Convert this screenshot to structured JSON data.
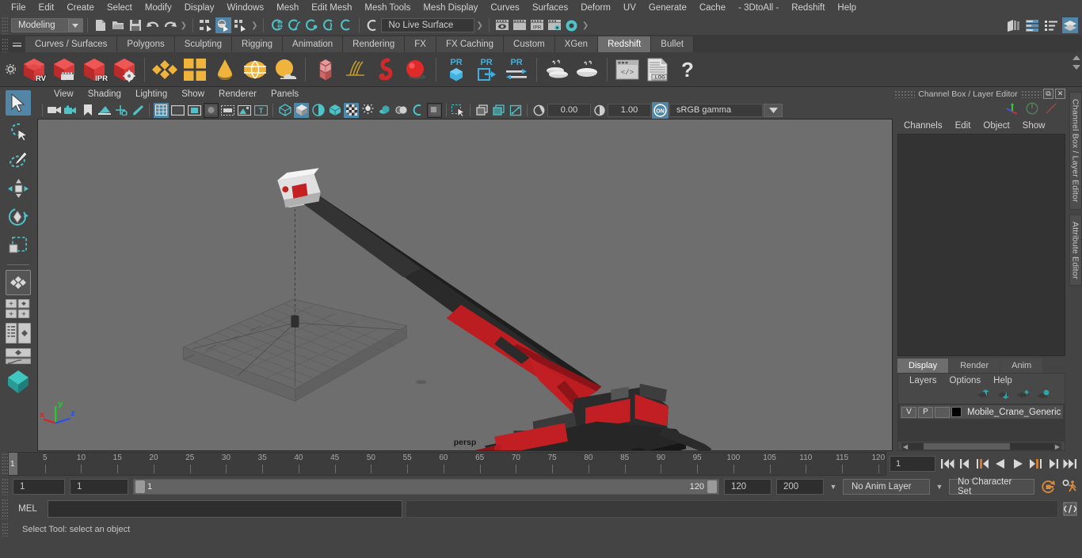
{
  "menu": {
    "items": [
      "File",
      "Edit",
      "Create",
      "Select",
      "Modify",
      "Display",
      "Windows",
      "Mesh",
      "Edit Mesh",
      "Mesh Tools",
      "Mesh Display",
      "Curves",
      "Surfaces",
      "Deform",
      "UV",
      "Generate",
      "Cache",
      "- 3DtoAll -",
      "Redshift",
      "Help"
    ]
  },
  "status": {
    "mode": "Modeling",
    "live_surface": "No Live Surface",
    "icons": [
      "new-scene-icon",
      "open-scene-icon",
      "save-scene-icon",
      "undo-icon",
      "redo-icon",
      "select-hierarchy-icon",
      "select-object-icon",
      "select-component-icon",
      "snap-grid-icon",
      "snap-curve-icon",
      "snap-point-icon",
      "snap-view-plane-icon",
      "make-live-icon",
      "render-view-icon",
      "render-sequence-icon",
      "ipr-render-icon",
      "render-settings-icon",
      "hypershade-icon"
    ]
  },
  "shelf": {
    "tabs": [
      "Curves / Surfaces",
      "Polygons",
      "Sculpting",
      "Rigging",
      "Animation",
      "Rendering",
      "FX",
      "FX Caching",
      "Custom",
      "XGen",
      "Redshift",
      "Bullet"
    ],
    "active_tab": "Redshift",
    "buttons": [
      {
        "name": "redshift-render-view",
        "label": "RV"
      },
      {
        "name": "redshift-render-sequence",
        "label": ""
      },
      {
        "name": "redshift-ipr",
        "label": "IPR"
      },
      {
        "name": "redshift-render-settings",
        "label": ""
      },
      {
        "name": "redshift-proxy",
        "label": ""
      },
      {
        "name": "redshift-matte",
        "label": ""
      },
      {
        "name": "redshift-light-dome",
        "label": ""
      },
      {
        "name": "redshift-environment",
        "label": ""
      },
      {
        "name": "redshift-sky",
        "label": ""
      },
      {
        "name": "redshift-volume",
        "label": ""
      },
      {
        "name": "redshift-hair",
        "label": ""
      },
      {
        "name": "redshift-curve",
        "label": ""
      },
      {
        "name": "redshift-sphere",
        "label": ""
      },
      {
        "name": "redshift-pr-proxy",
        "label": "PR"
      },
      {
        "name": "redshift-pr-export",
        "label": "PR"
      },
      {
        "name": "redshift-pr-transfer",
        "label": "PR"
      },
      {
        "name": "redshift-bake-set",
        "label": ""
      },
      {
        "name": "redshift-bake-all",
        "label": ""
      },
      {
        "name": "redshift-script-editor",
        "label": ""
      },
      {
        "name": "redshift-log",
        "label": ".LOG"
      },
      {
        "name": "redshift-help",
        "label": "?"
      }
    ]
  },
  "toolbox": {
    "items": [
      {
        "name": "select-tool",
        "selected": true
      },
      {
        "name": "lasso-select-tool",
        "selected": false
      },
      {
        "name": "paint-select-tool",
        "selected": false
      },
      {
        "name": "move-tool",
        "selected": false
      },
      {
        "name": "rotate-tool",
        "selected": false
      },
      {
        "name": "scale-tool",
        "selected": false
      },
      {
        "name": "last-tool-used",
        "selected": false
      },
      {
        "name": "layout-four-view",
        "selected": false
      },
      {
        "name": "layout-persp-outliner",
        "selected": false
      },
      {
        "name": "layout-persp-graph",
        "selected": false
      },
      {
        "name": "layout-single-perspective",
        "selected": false
      }
    ]
  },
  "viewport": {
    "menus": [
      "View",
      "Shading",
      "Lighting",
      "Show",
      "Renderer",
      "Panels"
    ],
    "exposure": "0.00",
    "gamma": "1.00",
    "color_space": "sRGB gamma",
    "view_label": "persp",
    "axis": {
      "x": "x",
      "y": "y",
      "z": "z"
    },
    "background_color": "#6e6e6e",
    "model_name": "Mobile Crane with load platform"
  },
  "channel_box": {
    "title": "Channel Box / Layer Editor",
    "menus": [
      "Channels",
      "Edit",
      "Object",
      "Show"
    ],
    "layer_tabs": [
      "Display",
      "Render",
      "Anim"
    ],
    "active_layer_tab": "Display",
    "layer_menus": [
      "Layers",
      "Options",
      "Help"
    ],
    "layers": [
      {
        "visibility": "V",
        "playback": "P",
        "shading": "",
        "color": "#000000",
        "name": "Mobile_Crane_Generic"
      }
    ]
  },
  "side_tabs": [
    "Channel Box / Layer Editor",
    "Attribute Editor"
  ],
  "timeline": {
    "ticks": [
      5,
      10,
      15,
      20,
      25,
      30,
      35,
      40,
      45,
      50,
      55,
      60,
      65,
      70,
      75,
      80,
      85,
      90,
      95,
      100,
      105,
      110,
      115,
      120
    ],
    "current_frame": "1",
    "current_frame_field": "1",
    "playback_buttons": [
      "go-to-start",
      "step-back-key",
      "step-back-frame",
      "play-backwards",
      "play-forwards",
      "step-forward-frame",
      "step-forward-key",
      "go-to-end"
    ]
  },
  "range": {
    "anim_start": "1",
    "range_start": "1",
    "slider_min_label": "1",
    "slider_max_label": "120",
    "range_end": "120",
    "anim_end": "200",
    "anim_layer": "No Anim Layer",
    "character_set": "No Character Set",
    "auto_key_icon": "auto-keyframe-icon",
    "prefs_icon": "animation-preferences-icon"
  },
  "command_line": {
    "label": "MEL",
    "input_value": "",
    "output_value": ""
  },
  "help_line": {
    "text": "Select Tool: select an object"
  },
  "colors": {
    "accent_blue": "#5285a6",
    "panel_bg": "#444444",
    "viewport_bg": "#6e6e6e",
    "crane_red": "#c01f22"
  }
}
